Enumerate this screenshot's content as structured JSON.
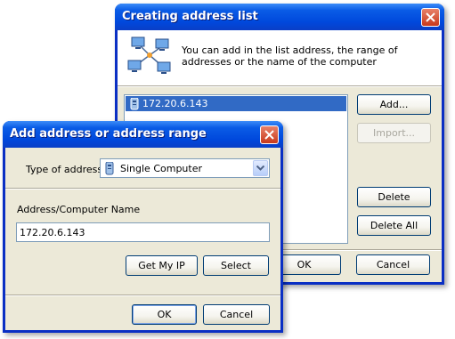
{
  "back_dialog": {
    "title": "Creating address list",
    "description": "You can add in the list address, the range of addresses or the name of the computer",
    "list_items": [
      "172.20.6.143"
    ],
    "buttons": {
      "add": "Add...",
      "import": "Import...",
      "delete": "Delete",
      "delete_all": "Delete All",
      "ok": "OK",
      "cancel": "Cancel"
    }
  },
  "front_dialog": {
    "title": "Add address or address range",
    "type_label": "Type of address",
    "type_value": "Single Computer",
    "address_label": "Address/Computer Name",
    "address_value": "172.20.6.143",
    "buttons": {
      "get_my_ip": "Get My IP",
      "select": "Select",
      "ok": "OK",
      "cancel": "Cancel"
    }
  },
  "colors": {
    "titlebar": "#0a5ce6",
    "dialog_bg": "#ece9d8",
    "selection": "#316ac5",
    "close_button": "#c8391c"
  },
  "icons": [
    "network-computers-icon",
    "computer-icon",
    "close-icon",
    "dropdown-arrow-icon"
  ]
}
